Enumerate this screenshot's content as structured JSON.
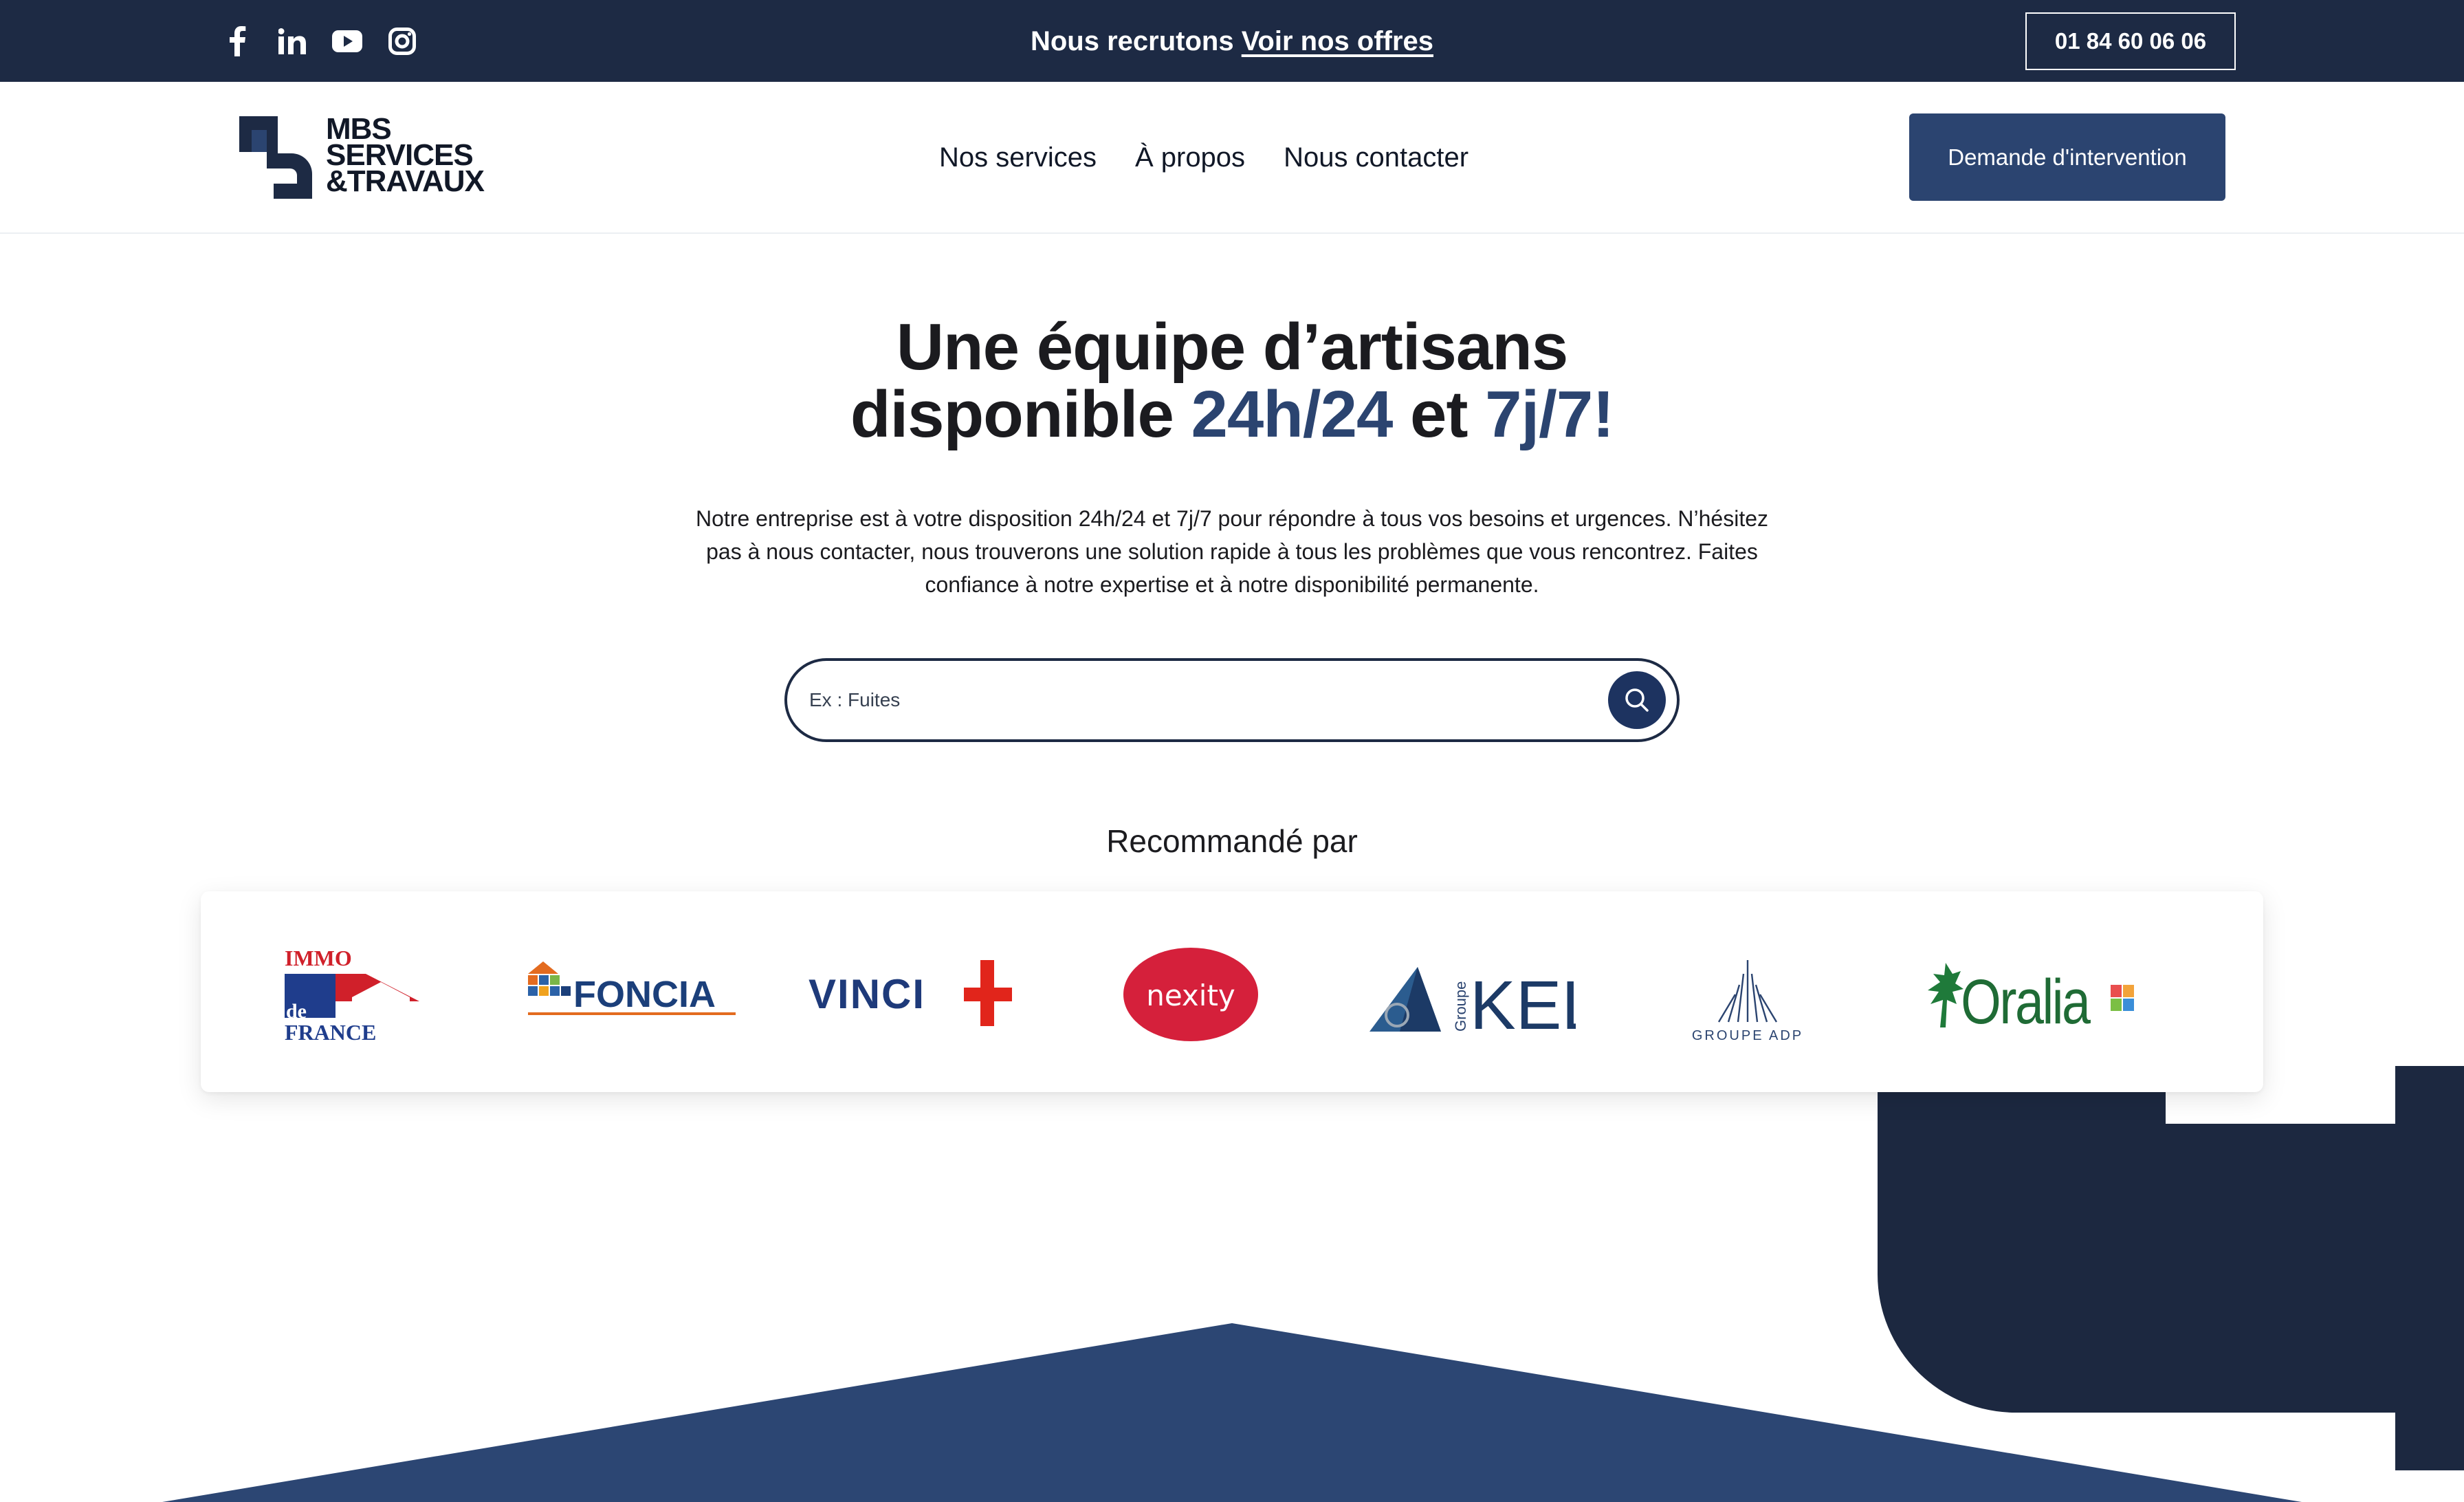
{
  "topbar": {
    "recruit_text": "Nous recrutons",
    "recruit_link": "Voir nos offres",
    "phone": "01 84 60 06 06",
    "socials": [
      "facebook-icon",
      "linkedin-icon",
      "youtube-icon",
      "instagram-icon"
    ]
  },
  "header": {
    "logo_lines": [
      "MBS",
      "SERVICES",
      "&TRAVAUX"
    ],
    "nav": [
      "Nos services",
      "À propos",
      "Nous contacter"
    ],
    "cta": "Demande d'intervention"
  },
  "hero": {
    "title_line1": "Une équipe d’artisans",
    "title_line2_a": "disponible ",
    "title_line2_b": "24h/24",
    "title_line2_c": " et ",
    "title_line2_d": "7j/7!",
    "description": "Notre entreprise est à votre disposition 24h/24 et 7j/7 pour répondre à tous vos besoins et urgences. N’hésitez pas à nous contacter, nous trouverons une solution rapide à tous les problèmes que vous rencontrez. Faites confiance à notre expertise et à notre disponibilité permanente."
  },
  "search": {
    "placeholder": "Ex : Fuites",
    "icon": "search-icon"
  },
  "recommended": {
    "title": "Recommandé par",
    "partners": [
      {
        "name": "IMMO de FRANCE",
        "line1": "IMMO",
        "line2": "de",
        "line3": "FRANCE"
      },
      {
        "name": "FONCIA",
        "label": "FONCIA"
      },
      {
        "name": "VINCI",
        "label": "VINCI"
      },
      {
        "name": "nexity",
        "label": "nexity"
      },
      {
        "name": "Groupe KEL",
        "label": "KEL",
        "small": "Groupe"
      },
      {
        "name": "GROUPE ADP",
        "label": "GROUPE ADP"
      },
      {
        "name": "Oralia",
        "label": "Oralia"
      }
    ]
  },
  "colors": {
    "navy": "#1d2a44",
    "accent": "#2b4470",
    "deco_dark": "#1c2840",
    "deco_blue": "#2c4673"
  }
}
